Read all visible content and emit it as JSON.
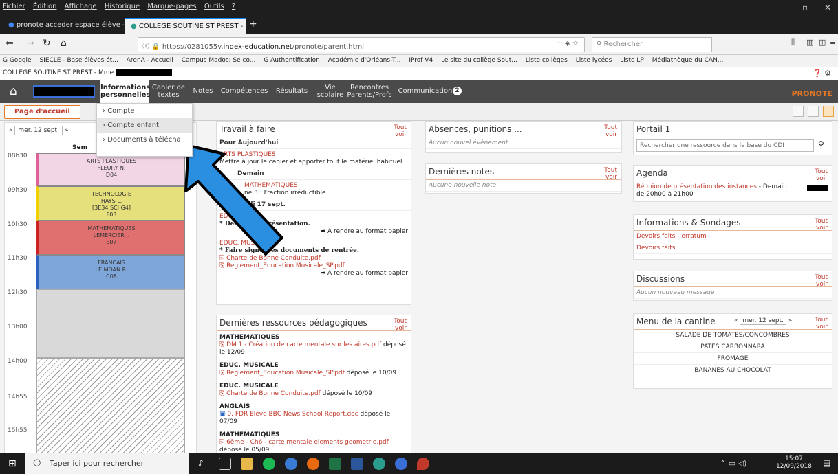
{
  "browser": {
    "menu": [
      "Fichier",
      "Édition",
      "Affichage",
      "Historique",
      "Marque-pages",
      "Outils",
      "?"
    ],
    "tabs": [
      {
        "label": "pronote acceder espace élève -"
      },
      {
        "label": "COLLEGE SOUTINE ST PREST -"
      }
    ],
    "url_prefix": "https://0281055v.",
    "url_domain": "index-education.net",
    "url_path": "/pronote/parent.html",
    "search_placeholder": "Rechercher",
    "url_dots": "···",
    "bookmarks": [
      "G Google",
      "SIECLE - Base élèves ét...",
      "ArenA - Accueil",
      "Campus Mados: Se co...",
      "G Authentification",
      "Académie d'Orléans-T...",
      "IProf V4",
      "Le site du collège Sout...",
      "Liste collèges",
      "Liste lycées",
      "Liste LP",
      "Médiathèque du CAN..."
    ]
  },
  "site": {
    "header": "COLLEGE SOUTINE ST PREST - Mme",
    "nav": [
      {
        "label": "Informations personnelles"
      },
      {
        "label": "Cahier de textes"
      },
      {
        "label": "Notes"
      },
      {
        "label": "Compétences"
      },
      {
        "label": "Résultats"
      },
      {
        "label": "Vie scolaire"
      },
      {
        "label": "Rencontres Parents/Profs"
      },
      {
        "label": "Communication"
      }
    ],
    "comm_badge": "2",
    "brand": "PRONOTE",
    "home_tab": "Page d'accueil",
    "dropdown": [
      "Compte",
      "Compte enfant",
      "Documents à télécha"
    ]
  },
  "schedule": {
    "date": "mer. 12 sept.",
    "week": "Sem",
    "tout": "Tout voir",
    "times": [
      "08h30",
      "09h30",
      "10h30",
      "11h30",
      "12h30",
      "13h00",
      "14h00",
      "14h55",
      "15h55"
    ],
    "courses": [
      {
        "subject": "ARTS PLASTIQUES",
        "teacher": "FLEURY N.",
        "room": "D04",
        "color": "#f3d6e6",
        "bar": "#e0609a"
      },
      {
        "subject": "TECHNOLOGIE",
        "teacher": "HAYS L.",
        "group": "[3E34 SCI G4]",
        "room": "F03",
        "color": "#e6e07c",
        "bar": "#f0d000"
      },
      {
        "subject": "MATHEMATIQUES",
        "teacher": "LEMERCIER J.",
        "room": "E07",
        "color": "#e07070",
        "bar": "#cc2222"
      },
      {
        "subject": "FRANCAIS",
        "teacher": "LE MOAN R.",
        "room": "C08",
        "color": "#7fa6d8",
        "bar": "#2a64c0"
      }
    ]
  },
  "travail": {
    "title": "Travail à faire",
    "tout": "Tout voir",
    "today": "Pour Aujourd'hui",
    "item1_subject": "ARTS PLASTIQUES",
    "item1_text": "Mettre à jour le cahier et apporter tout le matériel habituel",
    "tomorrow": "Demain",
    "item2_subject": "MATHEMATIQUES",
    "item2_text": "ne 3 : Fraction irréductible",
    "friday": "di 17 sept.",
    "item3_subject": "EDUC. ...LE",
    "item3_text": "* Décor... de présentation.",
    "render_paper": "A rendre au format papier",
    "item4_subject": "EDUC. MUSICALE",
    "item4_text": "* Faire signer les documents de rentrée.",
    "item4_file1": "Charte de Bonne Conduite.pdf",
    "item4_file2": "Reglement_Education Musicale_SP.pdf",
    "render_paper2": "A rendre au format papier"
  },
  "ressources": {
    "title": "Dernières ressources pédagogiques",
    "tout": "Tout voir",
    "items": [
      {
        "subject": "MATHEMATIQUES",
        "file": "DM 1 - Création de carte mentale sur les aires.pdf",
        "meta": "déposé le 12/09"
      },
      {
        "subject": "EDUC. MUSICALE",
        "file": "Reglement_Education Musicale_SP.pdf",
        "meta": "déposé le 10/09"
      },
      {
        "subject": "EDUC. MUSICALE",
        "file": "Charte de Bonne Conduite.pdf",
        "meta": "déposé le 10/09"
      },
      {
        "subject": "ANGLAIS",
        "file": "0. FDR Elève BBC News School Report.doc",
        "meta": "déposé le 07/09"
      },
      {
        "subject": "MATHEMATIQUES",
        "file": "6ème - Ch6 - carte mentale elements geometrie.pdf",
        "meta": "déposé le 05/09"
      }
    ]
  },
  "absences": {
    "title": "Absences, punitions ...",
    "tout": "Tout voir",
    "empty": "Aucun nouvel évènement"
  },
  "notes": {
    "title": "Dernières notes",
    "tout": "Tout voir",
    "empty": "Aucune nouvelle note"
  },
  "portail": {
    "title": "Portail 1",
    "placeholder": "Rechercher une ressource dans la base du CDI"
  },
  "agenda": {
    "title": "Agenda",
    "tout": "Tout voir",
    "item": "Réunion de présentation des instances",
    "item_rest": " - Demain de 20h00 à 21h00"
  },
  "infos": {
    "title": "Informations & Sondages",
    "tout": "Tout voir",
    "items": [
      "Devoirs faits - erratum",
      "Devoirs faits"
    ]
  },
  "discussions": {
    "title": "Discussions",
    "tout": "Tout voir",
    "empty": "Aucun nouveau message"
  },
  "cantine": {
    "title": "Menu de la cantine",
    "date": "mer. 12 sept.",
    "tout": "Tout voir",
    "items": [
      "SALADE DE TOMATES/CONCOMBRES",
      "PATES CARBONNARA",
      "FROMAGE",
      "BANANES AU CHOCOLAT"
    ]
  },
  "taskbar": {
    "search": "Taper ici pour rechercher",
    "time": "15:07",
    "date": "12/09/2018"
  }
}
